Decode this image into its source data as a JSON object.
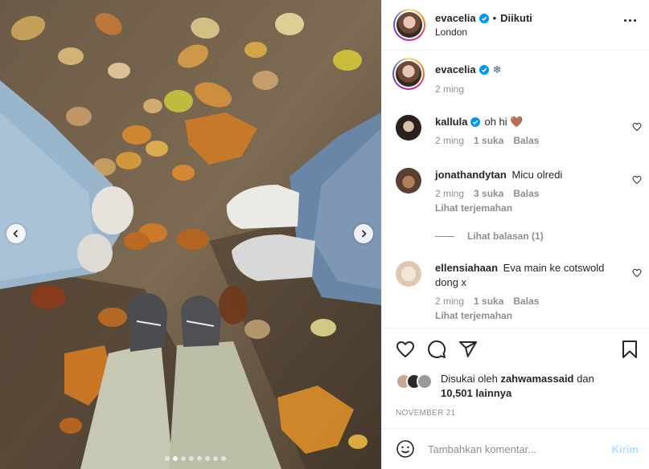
{
  "post": {
    "author": "evacelia",
    "follow_state": "Diikuti",
    "location": "London",
    "separator": "•",
    "caption_emoji": "❄",
    "caption_time": "2 ming"
  },
  "comments": [
    {
      "user": "kallula",
      "verified": true,
      "text": "oh hi 🤎",
      "time": "2 ming",
      "likes": "1 suka",
      "reply": "Balas",
      "translate": ""
    },
    {
      "user": "jonathandytan",
      "verified": false,
      "text": "Micu olredi",
      "time": "2 ming",
      "likes": "3 suka",
      "reply": "Balas",
      "translate": "Lihat terjemahan"
    },
    {
      "user": "ellensiahaan",
      "verified": false,
      "text": "Eva main ke cotswold dong x",
      "time": "2 ming",
      "likes": "1 suka",
      "reply": "Balas",
      "translate": "Lihat terjemahan"
    }
  ],
  "view_replies": "Lihat balasan (1)",
  "likes": {
    "prefix": "Disukai oleh",
    "user": "zahwamassaid",
    "joiner": "dan",
    "count": "10,501 lainnya"
  },
  "date": "NOVEMBER 21",
  "add_comment": {
    "placeholder": "Tambahkan komentar...",
    "post_label": "Kirim"
  },
  "carousel": {
    "slides": 8,
    "active": 1
  },
  "icons": [
    "heart-icon",
    "comment-icon",
    "share-icon",
    "bookmark-icon",
    "emoji-icon",
    "more-icon",
    "verified-icon",
    "chevron-left-icon",
    "chevron-right-icon"
  ],
  "colors": {
    "verified": "#0095f6",
    "post_disabled": "#b2dffc",
    "muted": "#8e8e8e"
  }
}
